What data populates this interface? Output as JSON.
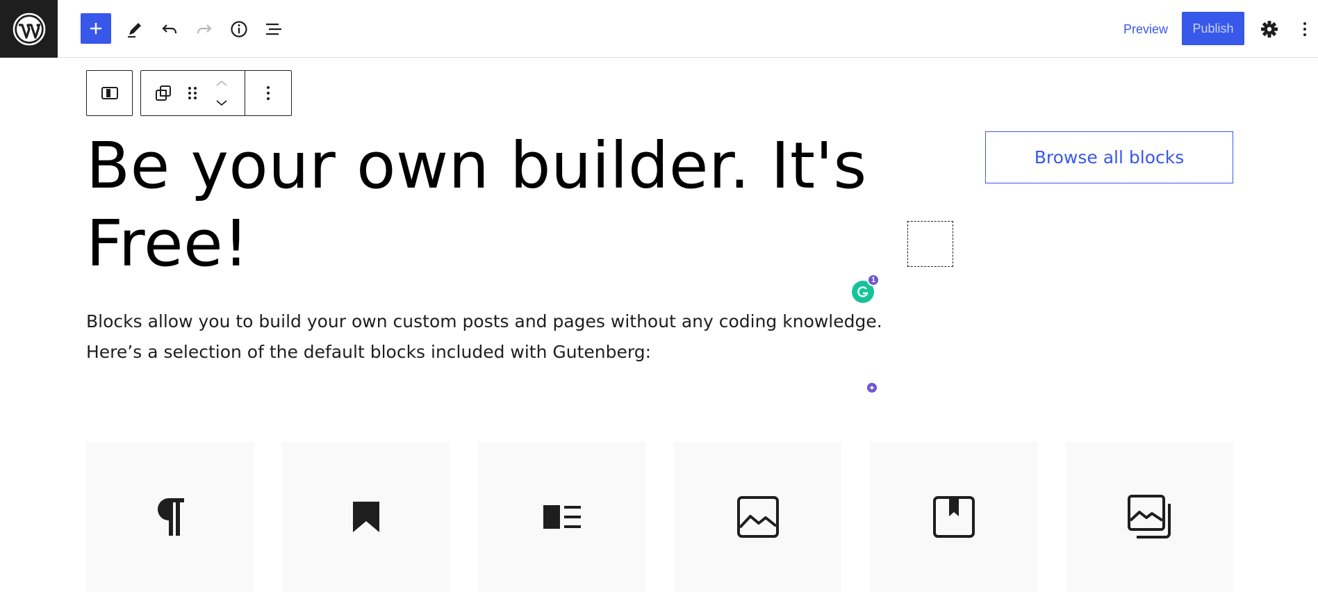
{
  "topbar": {
    "logo_icon": "wordpress-logo",
    "add_block_icon": "plus-icon",
    "tools_icon": "pencil-icon",
    "undo_icon": "undo-icon",
    "redo_icon": "redo-icon",
    "details_icon": "info-icon",
    "list_view_icon": "list-view-icon",
    "preview_label": "Preview",
    "publish_label": "Publish",
    "settings_icon": "gear-icon",
    "options_icon": "more-vertical-icon",
    "accent_color": "#3858e9"
  },
  "block_toolbar": {
    "block_type_icon": "media-text-icon",
    "transform_icon": "duplicate-icon",
    "drag_icon": "drag-handle-icon",
    "move_up_icon": "chevron-up-icon",
    "move_down_icon": "chevron-down-icon",
    "options_icon": "more-vertical-icon"
  },
  "content": {
    "heading_line1": "Be your own builder. It's",
    "heading_line2": "Free!",
    "browse_button": "Browse all blocks",
    "paragraph_line1": "Blocks allow you to build your own custom posts and pages without any coding knowledge.",
    "paragraph_line2": "Here’s a selection of the default blocks included with Gutenberg:",
    "grammarly_count": "1"
  },
  "tiles": [
    {
      "icon": "paragraph-icon"
    },
    {
      "icon": "bookmark-icon"
    },
    {
      "icon": "media-text-icon"
    },
    {
      "icon": "image-icon"
    },
    {
      "icon": "cover-icon"
    },
    {
      "icon": "gallery-icon"
    }
  ]
}
